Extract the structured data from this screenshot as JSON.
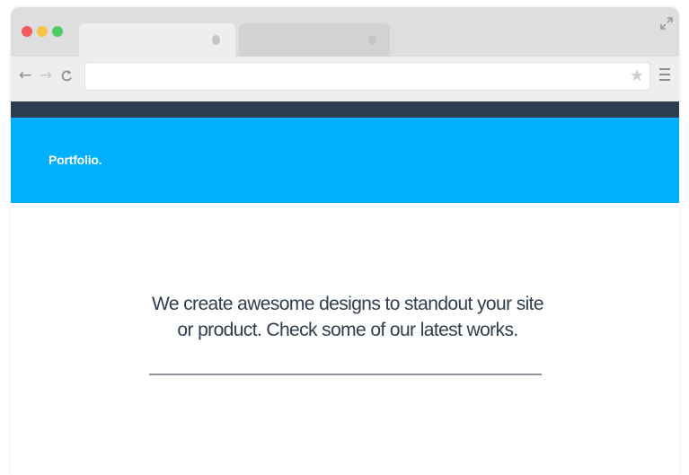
{
  "browser": {
    "traffic_lights": [
      {
        "name": "close-dot",
        "color": "#f15c5c"
      },
      {
        "name": "minimize-dot",
        "color": "#f7c346"
      },
      {
        "name": "zoom-dot",
        "color": "#4ecb64"
      }
    ],
    "tabs": [
      {
        "label": ""
      },
      {
        "label": ""
      }
    ],
    "address_bar": {
      "value": "",
      "placeholder": ""
    },
    "icons": {
      "back": "arrow-left-icon",
      "forward": "arrow-right-icon",
      "reload": "reload-icon",
      "bookmark": "star-icon",
      "menu": "hamburger-menu-icon",
      "expand": "expand-icon"
    }
  },
  "site": {
    "brand": "Portfolio.",
    "tagline_line1": "We create awesome designs to standout your site",
    "tagline_line2": "or product. Check some of our latest works."
  },
  "colors": {
    "top_bar": "#2d3e50",
    "hero_background": "#00b0ff",
    "heading_text": "#2f3d4c",
    "divider": "#8e959c"
  }
}
